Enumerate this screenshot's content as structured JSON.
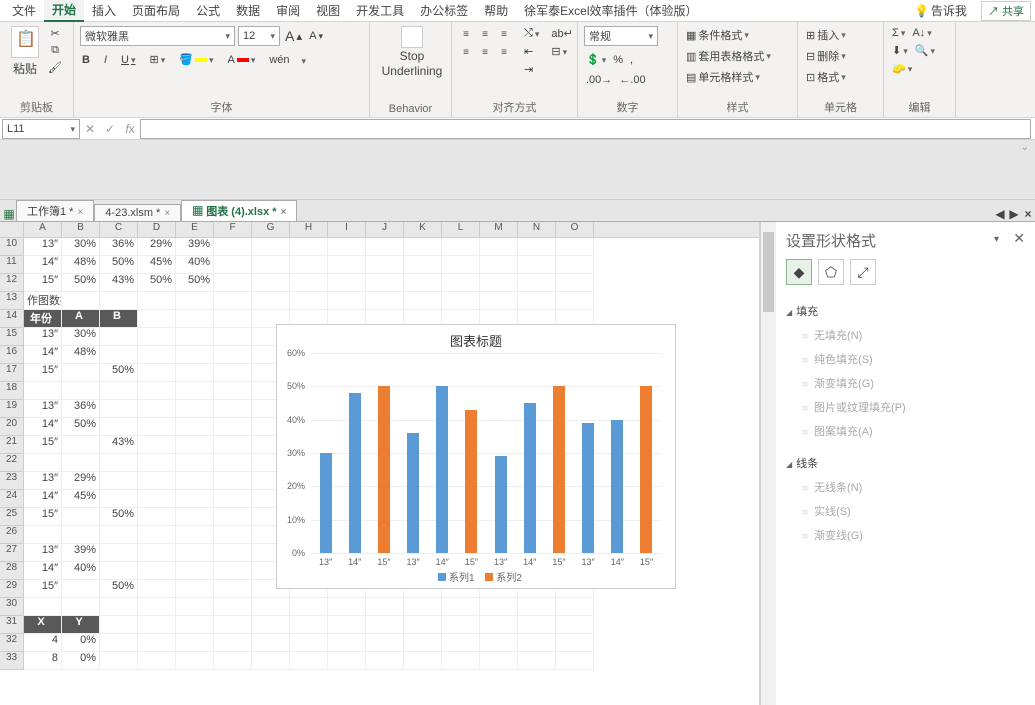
{
  "menu": {
    "items": [
      "文件",
      "开始",
      "插入",
      "页面布局",
      "公式",
      "数据",
      "审阅",
      "视图",
      "开发工具",
      "办公标签",
      "帮助",
      "徐军泰Excel效率插件（体验版）"
    ],
    "active_index": 1,
    "tell_me": "告诉我",
    "share": "共享"
  },
  "ribbon": {
    "clipboard": {
      "paste": "粘贴",
      "label": "剪贴板"
    },
    "font": {
      "name": "微软雅黑",
      "size": "12",
      "grow": "A",
      "shrink": "A",
      "bold": "B",
      "italic": "I",
      "underline": "U",
      "wen": "wén",
      "label": "字体"
    },
    "behavior": {
      "line1": "Stop",
      "line2": "Underlining",
      "label": "Behavior"
    },
    "align": {
      "label": "对齐方式"
    },
    "number": {
      "format": "常规",
      "label": "数字"
    },
    "styles": {
      "cond": "条件格式",
      "table": "套用表格格式",
      "cell": "单元格样式",
      "label": "样式"
    },
    "cells": {
      "insert": "插入",
      "delete": "删除",
      "format": "格式",
      "label": "单元格"
    },
    "editing": {
      "label": "编辑"
    }
  },
  "formula_bar": {
    "name_box": "L11"
  },
  "tabs": [
    {
      "label": "工作簿1 *",
      "active": false
    },
    {
      "label": "4-23.xlsm *",
      "active": false
    },
    {
      "label": "图表 (4).xlsx *",
      "active": true
    }
  ],
  "columns": [
    "A",
    "B",
    "C",
    "D",
    "E",
    "F",
    "G",
    "H",
    "I",
    "J",
    "K",
    "L",
    "M",
    "N",
    "O"
  ],
  "row_data": {
    "start_row": 10,
    "top_rows": [
      [
        "13″",
        "30%",
        "36%",
        "29%",
        "39%"
      ],
      [
        "14″",
        "48%",
        "50%",
        "45%",
        "40%"
      ],
      [
        "15″",
        "50%",
        "43%",
        "50%",
        "50%"
      ]
    ],
    "plot_label": "作图数据",
    "header": [
      "年份",
      "A",
      "B"
    ],
    "bottom_rows": [
      [
        "13″",
        "30%",
        ""
      ],
      [
        "14″",
        "48%",
        ""
      ],
      [
        "15″",
        "",
        "50%"
      ],
      [
        "",
        "",
        ""
      ],
      [
        "13″",
        "36%",
        ""
      ],
      [
        "14″",
        "50%",
        ""
      ],
      [
        "15″",
        "",
        "43%"
      ],
      [
        "",
        "",
        ""
      ],
      [
        "13″",
        "29%",
        ""
      ],
      [
        "14″",
        "45%",
        ""
      ],
      [
        "15″",
        "",
        "50%"
      ],
      [
        "",
        "",
        ""
      ],
      [
        "13″",
        "39%",
        ""
      ],
      [
        "14″",
        "40%",
        ""
      ],
      [
        "15″",
        "",
        "50%"
      ],
      [
        "",
        "",
        ""
      ]
    ],
    "xy_header": [
      "X",
      "Y"
    ],
    "xy_rows": [
      [
        "4",
        "0%"
      ],
      [
        "8",
        "0%"
      ]
    ]
  },
  "chart_data": {
    "type": "bar",
    "title": "图表标题",
    "ylim": [
      0,
      0.6
    ],
    "yticks": [
      "0%",
      "10%",
      "20%",
      "30%",
      "40%",
      "50%",
      "60%"
    ],
    "groups": [
      {
        "labels": [
          "13″",
          "14″",
          "15″"
        ],
        "s1": [
          0.3,
          0.48,
          null
        ],
        "s2": [
          null,
          null,
          0.5
        ]
      },
      {
        "labels": [
          "13″",
          "14″",
          "15″"
        ],
        "s1": [
          0.36,
          0.5,
          null
        ],
        "s2": [
          null,
          null,
          0.43
        ]
      },
      {
        "labels": [
          "13″",
          "14″",
          "15″"
        ],
        "s1": [
          0.29,
          0.45,
          null
        ],
        "s2": [
          null,
          null,
          0.5
        ]
      },
      {
        "labels": [
          "13″",
          "14″",
          "15″"
        ],
        "s1": [
          0.39,
          0.4,
          null
        ],
        "s2": [
          null,
          null,
          0.5
        ]
      }
    ],
    "legend": [
      "系列1",
      "系列2"
    ]
  },
  "sidebar": {
    "title": "设置形状格式",
    "fill": {
      "head": "填充",
      "opts": [
        "无填充(N)",
        "纯色填充(S)",
        "渐变填充(G)",
        "图片或纹理填充(P)",
        "图案填充(A)"
      ]
    },
    "line": {
      "head": "线条",
      "opts": [
        "无线条(N)",
        "实线(S)",
        "渐变线(G)"
      ]
    }
  }
}
